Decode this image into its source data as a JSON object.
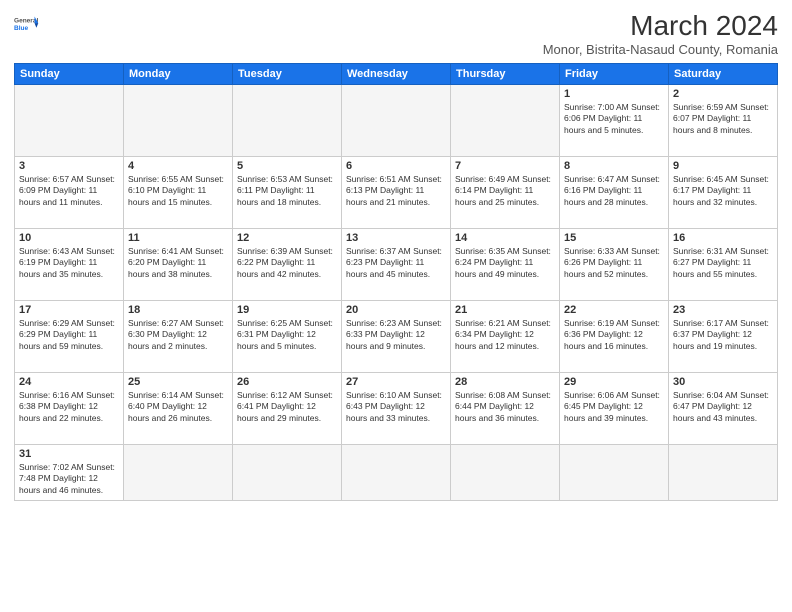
{
  "header": {
    "logo_general": "General",
    "logo_blue": "Blue",
    "title": "March 2024",
    "subtitle": "Monor, Bistrita-Nasaud County, Romania"
  },
  "weekdays": [
    "Sunday",
    "Monday",
    "Tuesday",
    "Wednesday",
    "Thursday",
    "Friday",
    "Saturday"
  ],
  "weeks": [
    [
      {
        "day": "",
        "info": ""
      },
      {
        "day": "",
        "info": ""
      },
      {
        "day": "",
        "info": ""
      },
      {
        "day": "",
        "info": ""
      },
      {
        "day": "",
        "info": ""
      },
      {
        "day": "1",
        "info": "Sunrise: 7:00 AM\nSunset: 6:06 PM\nDaylight: 11 hours and 5 minutes."
      },
      {
        "day": "2",
        "info": "Sunrise: 6:59 AM\nSunset: 6:07 PM\nDaylight: 11 hours and 8 minutes."
      }
    ],
    [
      {
        "day": "3",
        "info": "Sunrise: 6:57 AM\nSunset: 6:09 PM\nDaylight: 11 hours and 11 minutes."
      },
      {
        "day": "4",
        "info": "Sunrise: 6:55 AM\nSunset: 6:10 PM\nDaylight: 11 hours and 15 minutes."
      },
      {
        "day": "5",
        "info": "Sunrise: 6:53 AM\nSunset: 6:11 PM\nDaylight: 11 hours and 18 minutes."
      },
      {
        "day": "6",
        "info": "Sunrise: 6:51 AM\nSunset: 6:13 PM\nDaylight: 11 hours and 21 minutes."
      },
      {
        "day": "7",
        "info": "Sunrise: 6:49 AM\nSunset: 6:14 PM\nDaylight: 11 hours and 25 minutes."
      },
      {
        "day": "8",
        "info": "Sunrise: 6:47 AM\nSunset: 6:16 PM\nDaylight: 11 hours and 28 minutes."
      },
      {
        "day": "9",
        "info": "Sunrise: 6:45 AM\nSunset: 6:17 PM\nDaylight: 11 hours and 32 minutes."
      }
    ],
    [
      {
        "day": "10",
        "info": "Sunrise: 6:43 AM\nSunset: 6:19 PM\nDaylight: 11 hours and 35 minutes."
      },
      {
        "day": "11",
        "info": "Sunrise: 6:41 AM\nSunset: 6:20 PM\nDaylight: 11 hours and 38 minutes."
      },
      {
        "day": "12",
        "info": "Sunrise: 6:39 AM\nSunset: 6:22 PM\nDaylight: 11 hours and 42 minutes."
      },
      {
        "day": "13",
        "info": "Sunrise: 6:37 AM\nSunset: 6:23 PM\nDaylight: 11 hours and 45 minutes."
      },
      {
        "day": "14",
        "info": "Sunrise: 6:35 AM\nSunset: 6:24 PM\nDaylight: 11 hours and 49 minutes."
      },
      {
        "day": "15",
        "info": "Sunrise: 6:33 AM\nSunset: 6:26 PM\nDaylight: 11 hours and 52 minutes."
      },
      {
        "day": "16",
        "info": "Sunrise: 6:31 AM\nSunset: 6:27 PM\nDaylight: 11 hours and 55 minutes."
      }
    ],
    [
      {
        "day": "17",
        "info": "Sunrise: 6:29 AM\nSunset: 6:29 PM\nDaylight: 11 hours and 59 minutes."
      },
      {
        "day": "18",
        "info": "Sunrise: 6:27 AM\nSunset: 6:30 PM\nDaylight: 12 hours and 2 minutes."
      },
      {
        "day": "19",
        "info": "Sunrise: 6:25 AM\nSunset: 6:31 PM\nDaylight: 12 hours and 5 minutes."
      },
      {
        "day": "20",
        "info": "Sunrise: 6:23 AM\nSunset: 6:33 PM\nDaylight: 12 hours and 9 minutes."
      },
      {
        "day": "21",
        "info": "Sunrise: 6:21 AM\nSunset: 6:34 PM\nDaylight: 12 hours and 12 minutes."
      },
      {
        "day": "22",
        "info": "Sunrise: 6:19 AM\nSunset: 6:36 PM\nDaylight: 12 hours and 16 minutes."
      },
      {
        "day": "23",
        "info": "Sunrise: 6:17 AM\nSunset: 6:37 PM\nDaylight: 12 hours and 19 minutes."
      }
    ],
    [
      {
        "day": "24",
        "info": "Sunrise: 6:16 AM\nSunset: 6:38 PM\nDaylight: 12 hours and 22 minutes."
      },
      {
        "day": "25",
        "info": "Sunrise: 6:14 AM\nSunset: 6:40 PM\nDaylight: 12 hours and 26 minutes."
      },
      {
        "day": "26",
        "info": "Sunrise: 6:12 AM\nSunset: 6:41 PM\nDaylight: 12 hours and 29 minutes."
      },
      {
        "day": "27",
        "info": "Sunrise: 6:10 AM\nSunset: 6:43 PM\nDaylight: 12 hours and 33 minutes."
      },
      {
        "day": "28",
        "info": "Sunrise: 6:08 AM\nSunset: 6:44 PM\nDaylight: 12 hours and 36 minutes."
      },
      {
        "day": "29",
        "info": "Sunrise: 6:06 AM\nSunset: 6:45 PM\nDaylight: 12 hours and 39 minutes."
      },
      {
        "day": "30",
        "info": "Sunrise: 6:04 AM\nSunset: 6:47 PM\nDaylight: 12 hours and 43 minutes."
      }
    ],
    [
      {
        "day": "31",
        "info": "Sunrise: 7:02 AM\nSunset: 7:48 PM\nDaylight: 12 hours and 46 minutes."
      },
      {
        "day": "",
        "info": ""
      },
      {
        "day": "",
        "info": ""
      },
      {
        "day": "",
        "info": ""
      },
      {
        "day": "",
        "info": ""
      },
      {
        "day": "",
        "info": ""
      },
      {
        "day": "",
        "info": ""
      }
    ]
  ]
}
